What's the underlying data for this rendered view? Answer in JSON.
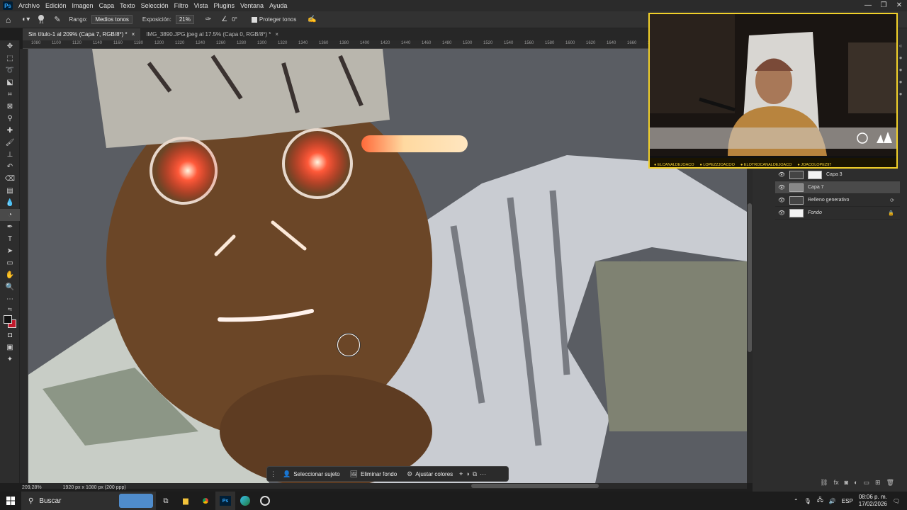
{
  "app": {
    "logo": "Ps"
  },
  "menu": [
    "Archivo",
    "Edición",
    "Imagen",
    "Capa",
    "Texto",
    "Selección",
    "Filtro",
    "Vista",
    "Plugins",
    "Ventana",
    "Ayuda"
  ],
  "options_bar": {
    "brush_size": "31",
    "rango_label": "Rango:",
    "rango_value": "Medios tonos",
    "exposicion_label": "Exposición:",
    "exposicion_value": "21%",
    "angle_value": "0°",
    "proteger_tonos": "Proteger tonos"
  },
  "tabs": [
    {
      "label": "Sin título-1 al 209% (Capa 7, RGB/8*) *",
      "close": "×",
      "active": true
    },
    {
      "label": "IMG_3890.JPG.jpeg al 17.5% (Capa 0, RGB/8*) *",
      "close": "×",
      "active": false
    }
  ],
  "ruler_ticks": [
    "1080",
    "1100",
    "1120",
    "1140",
    "1160",
    "1180",
    "1200",
    "1220",
    "1240",
    "1260",
    "1280",
    "1300",
    "1320",
    "1340",
    "1360",
    "1380",
    "1400",
    "1420",
    "1440",
    "1460",
    "1480",
    "1500",
    "1520",
    "1540",
    "1560",
    "1580",
    "1600",
    "1620",
    "1640",
    "1660",
    "1680"
  ],
  "status": {
    "zoom": "209,28%",
    "doc_size": "1920 px x 1080 px (200 ppp)"
  },
  "context_bar": {
    "select_subject": "Seleccionar sujeto",
    "remove_bg": "Eliminar fondo",
    "adjust_colors": "Ajustar colores"
  },
  "layers": [
    {
      "name": "Capa 3",
      "thumb": "dark",
      "selected": false,
      "lock": false
    },
    {
      "name": "Capa 7",
      "thumb": "gray",
      "selected": true,
      "lock": false
    },
    {
      "name": "Relleno generativo",
      "thumb": "dark",
      "selected": false,
      "lock": false
    },
    {
      "name": "Fondo",
      "thumb": "white",
      "selected": false,
      "lock": true
    }
  ],
  "webcam": {
    "ticker": [
      "ELCANALDEJOACO",
      "LOPEZZJOACOO",
      "ELOTROCANALDEJOACO",
      "JOACOLOPEZ97"
    ]
  },
  "taskbar": {
    "search_placeholder": "Buscar",
    "lang": "ESP",
    "time": "08:06 p. m.",
    "date": "17/02/2026"
  },
  "colors": {
    "ui_dark": "#2d2d2d",
    "accent_yellow": "#f2d12a",
    "ps_blue": "#31a8ff"
  }
}
